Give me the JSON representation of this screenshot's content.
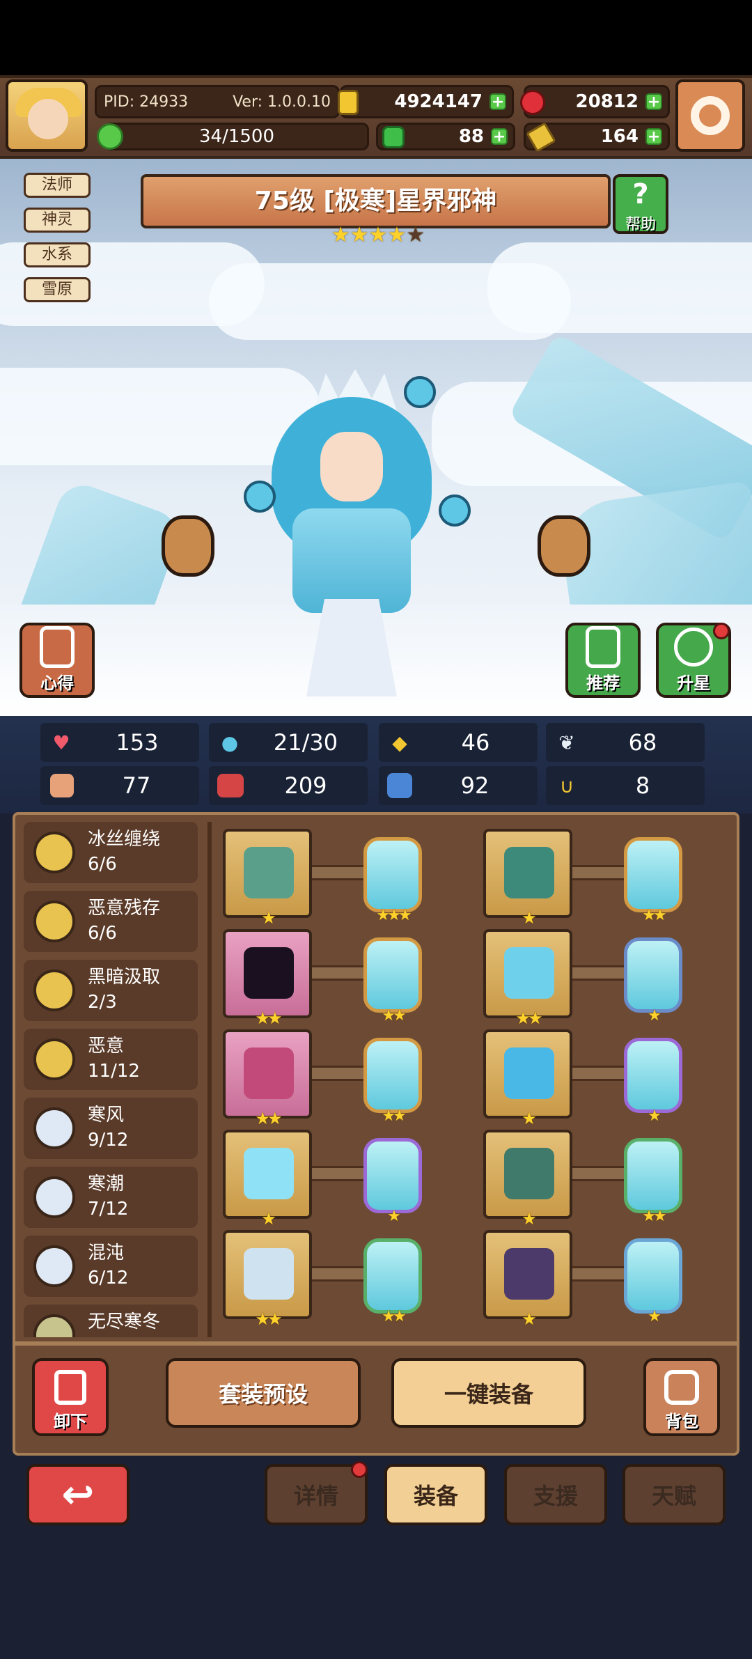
{
  "hud": {
    "pid": "PID: 24933",
    "version": "Ver: 1.0.0.10",
    "gold": "4924147",
    "ruby": "20812",
    "energy": "34/1500",
    "clover": "88",
    "key": "164"
  },
  "tags": [
    "法师",
    "神灵",
    "水系",
    "雪原"
  ],
  "hero": {
    "title": "75级  [极寒]星界邪神",
    "stars_filled": 4,
    "stars_total": 5,
    "help_label": "帮助"
  },
  "side_buttons": {
    "insight": "心得",
    "recommend": "推荐",
    "star_up": "升星"
  },
  "stats": [
    "153",
    "21/30",
    "46",
    "68",
    "77",
    "209",
    "92",
    "8"
  ],
  "sets": [
    {
      "name": "冰丝缠绕",
      "count": "6/6",
      "color": "#e9c34f"
    },
    {
      "name": "恶意残存",
      "count": "6/6",
      "color": "#e9c34f"
    },
    {
      "name": "黑暗汲取",
      "count": "2/3",
      "color": "#e9c34f"
    },
    {
      "name": "恶意",
      "count": "11/12",
      "color": "#e9c34f"
    },
    {
      "name": "寒风",
      "count": "9/12",
      "color": "#dfe8f5"
    },
    {
      "name": "寒潮",
      "count": "7/12",
      "color": "#dfe8f5"
    },
    {
      "name": "混沌",
      "count": "6/12",
      "color": "#dfe8f5"
    },
    {
      "name": "无尽寒冬",
      "count": "",
      "color": "#c8c48e"
    }
  ],
  "equipment": [
    {
      "item": "scepter-icon",
      "item_stars": 1,
      "gem_stars": 3,
      "gem_border": "#d39a43"
    },
    {
      "item": "cloak-icon",
      "item_stars": 1,
      "gem_stars": 2,
      "gem_border": "#d39a43"
    },
    {
      "item": "dark-orb-icon",
      "item_stars": 2,
      "gem_stars": 2,
      "gem_border": "#d39a43"
    },
    {
      "item": "ice-armor-icon",
      "item_stars": 2,
      "gem_stars": 1,
      "gem_border": "#6a8cc9"
    },
    {
      "item": "necklace-icon",
      "item_stars": 2,
      "gem_stars": 2,
      "gem_border": "#d39a43"
    },
    {
      "item": "ice-flame-icon",
      "item_stars": 1,
      "gem_stars": 1,
      "gem_border": "#9b6ad6"
    },
    {
      "item": "ice-crystal-icon",
      "item_stars": 1,
      "gem_stars": 1,
      "gem_border": "#9b6ad6"
    },
    {
      "item": "mask-icon",
      "item_stars": 1,
      "gem_stars": 2,
      "gem_border": "#59b06a"
    },
    {
      "item": "ice-ring-icon",
      "item_stars": 2,
      "gem_stars": 2,
      "gem_border": "#59b06a"
    },
    {
      "item": "boots-icon",
      "item_stars": 1,
      "gem_stars": 1,
      "gem_border": "#6aa7d6"
    }
  ],
  "actions": {
    "unequip": "卸下",
    "preset": "套装预设",
    "equip_all": "一键装备",
    "bag": "背包"
  },
  "tabs": [
    "详情",
    "装备",
    "支援",
    "天赋"
  ]
}
